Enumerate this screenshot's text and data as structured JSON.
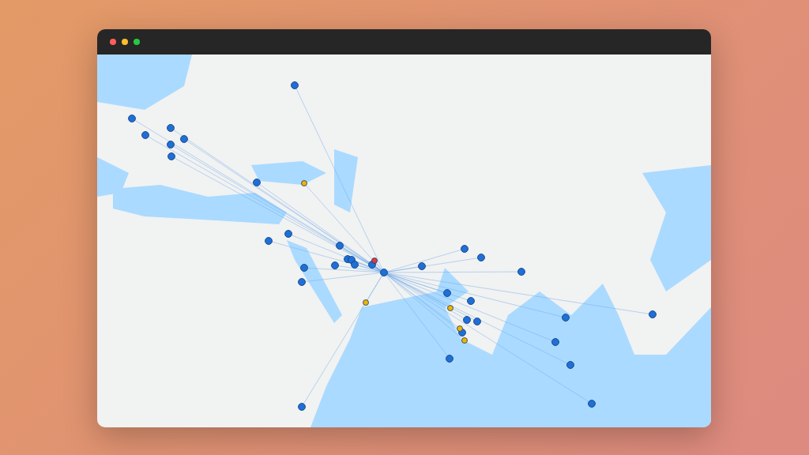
{
  "map": {
    "pins": [
      {
        "color": "#1f6fd6"
      },
      {
        "color": "#1f6fd6"
      },
      {
        "color": "#1f6fd6"
      },
      {
        "color": "#1f6fd6"
      },
      {
        "color": "#1f6fd6"
      },
      {
        "color": "#1f6fd6"
      },
      {
        "color": "#1f6fd6"
      },
      {
        "color": "#1f6fd6"
      },
      {
        "color": "#1f6fd6"
      },
      {
        "color": "#1f6fd6"
      },
      {
        "color": "#1f6fd6"
      },
      {
        "color": "#1f6fd6"
      },
      {
        "color": "#1f6fd6"
      },
      {
        "color": "#1f6fd6"
      },
      {
        "color": "#1f6fd6"
      },
      {
        "color": "#1f6fd6"
      },
      {
        "color": "#1f6fd6"
      },
      {
        "color": "#1f6fd6"
      },
      {
        "color": "#1f6fd6"
      },
      {
        "color": "#1f6fd6"
      },
      {
        "color": "#1f6fd6"
      },
      {
        "color": "#1f6fd6"
      },
      {
        "color": "#1f6fd6"
      },
      {
        "color": "#1f6fd6"
      },
      {
        "color": "#1f6fd6"
      },
      {
        "color": "#1f6fd6"
      },
      {
        "color": "#1f6fd6"
      },
      {
        "color": "#1f6fd6"
      },
      {
        "color": "#1f6fd6"
      },
      {
        "color": "#1f6fd6"
      },
      {
        "color": "#1f6fd6"
      },
      {
        "color": "#1f6fd6"
      },
      {
        "color": "#1f6fd6"
      },
      {
        "color": "#1f6fd6"
      },
      {
        "color": "#1f6fd6"
      },
      {
        "color": "#f0b400"
      },
      {
        "color": "#f0b400"
      },
      {
        "color": "#f0b400"
      },
      {
        "color": "#f0b400"
      },
      {
        "color": "#f0b400"
      },
      {
        "color": "#e53935"
      }
    ]
  }
}
